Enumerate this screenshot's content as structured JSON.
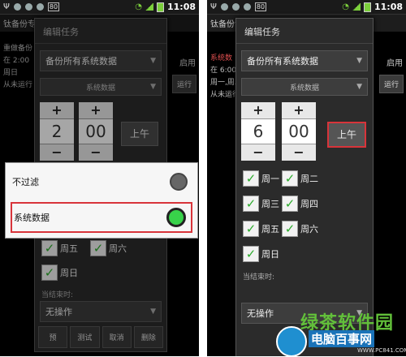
{
  "status_bar": {
    "time": "11:08",
    "badge": "80"
  },
  "left": {
    "bg_app": {
      "title": "钛备份专",
      "line1": "重做备份",
      "line2": "在 2:00",
      "line3": "周日",
      "line4": "从未运行",
      "right_label": "启用",
      "run_button": "运行"
    },
    "dialog": {
      "title": "编辑任务",
      "spinner_main": "备份所有系统数据",
      "spinner_filter": "系统数据",
      "hour": "2",
      "minute": "00",
      "ampm": "上午",
      "days": [
        "周五",
        "周六",
        "周日"
      ],
      "end_label": "当结束时:",
      "end_value": "无操作",
      "buttons": [
        "预",
        "测试",
        "取消",
        "删除"
      ]
    },
    "popup": {
      "items": [
        "不过滤",
        "系统数据"
      ]
    }
  },
  "right": {
    "bg_app": {
      "title": "钛备份专",
      "red_label": "系统数",
      "line2": "在 6:00",
      "line3": "周一,周二",
      "line4": "从未运行",
      "right_label": "启用",
      "run_button": "运行"
    },
    "dialog": {
      "title": "编辑任务",
      "spinner_main": "备份所有系统数据",
      "spinner_filter": "系统数据",
      "hour": "6",
      "minute": "00",
      "ampm": "上午",
      "days": [
        "周一",
        "周二",
        "周三",
        "周四",
        "周五",
        "周六",
        "周日"
      ],
      "end_label": "当结束时:",
      "end_value": "无操作"
    }
  },
  "watermark": {
    "main": "绿茶软件园",
    "sub": "电脑百事网",
    "url": "WWW.PC841.COM"
  },
  "colors": {
    "highlight": "#d8343a",
    "check": "#2bab2b",
    "radio_on": "#38d24a"
  }
}
